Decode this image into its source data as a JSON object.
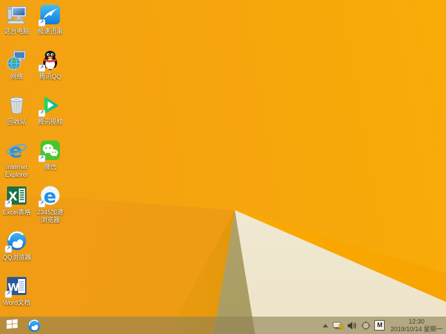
{
  "wallpaper": {
    "base_orange": "#f6a60c",
    "left_facet_orange": "#ee9a16",
    "khaki_triangle": "#b0a166",
    "cream_triangle": "#f3eedd",
    "highlight_strip": "#ffb300"
  },
  "desktop": {
    "icons": [
      {
        "name": "this-pc",
        "label": "这台电脑",
        "shortcut": false
      },
      {
        "name": "xunlei-speed",
        "label": "极速迅雷",
        "shortcut": true
      },
      {
        "name": "network",
        "label": "网络",
        "shortcut": false
      },
      {
        "name": "tencent-qq",
        "label": "腾讯QQ",
        "shortcut": true
      },
      {
        "name": "recycle-bin",
        "label": "回收站",
        "shortcut": false
      },
      {
        "name": "tencent-video",
        "label": "腾讯视频",
        "shortcut": true
      },
      {
        "name": "internet-explorer",
        "label": "Internet Explorer",
        "shortcut": false
      },
      {
        "name": "wechat",
        "label": "微信",
        "shortcut": true
      },
      {
        "name": "excel",
        "label": "Excel表格",
        "shortcut": true
      },
      {
        "name": "2345-browser",
        "label": "2345加速浏览器",
        "shortcut": true
      },
      {
        "name": "qq-browser",
        "label": "QQ浏览器",
        "shortcut": true
      },
      {
        "name": "word",
        "label": "Word文档",
        "shortcut": true
      }
    ]
  },
  "taskbar": {
    "start_icon": "windows-flag",
    "pinned_icons": [
      "qq-browser"
    ],
    "tray_icons": [
      "hidden-icons-chevron",
      "network-warning",
      "volume",
      "target-circle",
      "ime-indicator"
    ],
    "ime_indicator": "M",
    "clock": {
      "time": "12:30",
      "date": "2019/10/14 星期一"
    }
  }
}
